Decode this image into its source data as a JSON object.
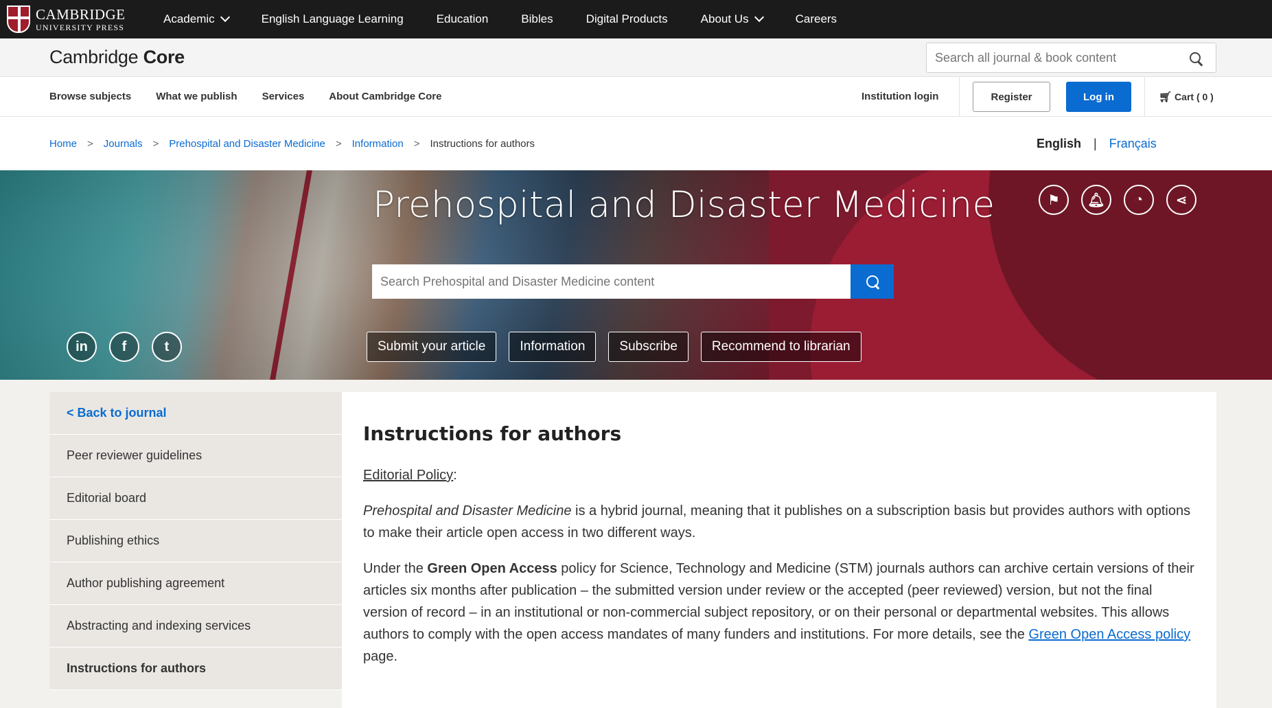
{
  "topbar": {
    "logo_line1": "CAMBRIDGE",
    "logo_line2": "UNIVERSITY PRESS",
    "nav": [
      "Academic",
      "English Language Learning",
      "Education",
      "Bibles",
      "Digital Products",
      "About Us",
      "Careers"
    ]
  },
  "corebar": {
    "logo_light": "Cambridge ",
    "logo_bold": "Core",
    "search_placeholder": "Search all journal & book content"
  },
  "subnav": {
    "items": [
      "Browse subjects",
      "What we publish",
      "Services",
      "About Cambridge Core"
    ],
    "institution_login": "Institution login",
    "register": "Register",
    "login": "Log in",
    "cart": "Cart ( 0 )"
  },
  "breadcrumb": {
    "items": [
      "Home",
      "Journals",
      "Prehospital and Disaster Medicine",
      "Information"
    ],
    "current": "Instructions for authors",
    "sep": ">"
  },
  "language": {
    "english": "English",
    "separator": "|",
    "french": "Français"
  },
  "banner": {
    "title": "Prehospital and Disaster Medicine",
    "search_placeholder": "Search Prehospital and Disaster Medicine content",
    "actions": [
      "Submit your article",
      "Information",
      "Subscribe",
      "Recommend to librarian"
    ],
    "socials": [
      "in",
      "f",
      "t"
    ]
  },
  "sidebar": {
    "back": "< Back to journal",
    "items": [
      "Peer reviewer guidelines",
      "Editorial board",
      "Publishing ethics",
      "Author publishing agreement",
      "Abstracting and indexing services",
      "Instructions for authors"
    ]
  },
  "main": {
    "heading": "Instructions for authors",
    "policy_label": "Editorial Policy",
    "policy_colon": ":",
    "p1_italic": "Prehospital and Disaster Medicine",
    "p1_rest": " is a hybrid journal, meaning that it publishes on a subscription basis but provides authors with options to make their article open access in two different ways.",
    "p2_start": "Under the ",
    "p2_bold": "Green Open Access",
    "p2_mid": " policy for Science, Technology and Medicine (STM) journals authors can archive certain versions of their articles six months after publication – the submitted version under review or the accepted (peer reviewed) version, but not the final version of record – in an institutional or non-commercial subject repository, or on their personal or departmental websites. This allows authors to comply with the open access mandates of many funders and institutions. For more details, see the ",
    "p2_link": "Green Open Access policy",
    "p2_end": " page."
  }
}
